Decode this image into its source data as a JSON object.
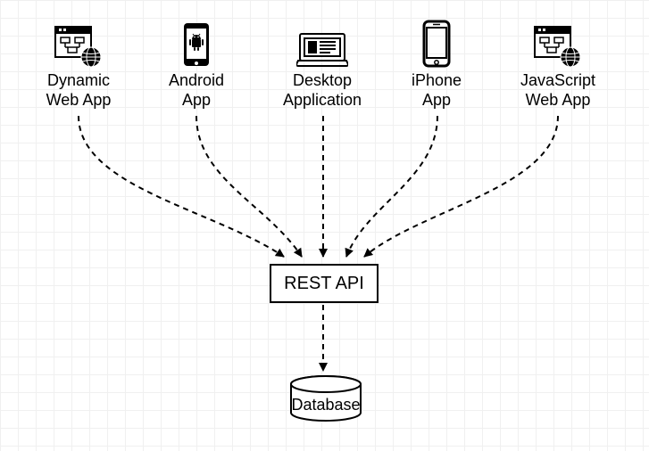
{
  "clients": {
    "dynamic": {
      "label": "Dynamic\nWeb App"
    },
    "android": {
      "label": "Android\nApp"
    },
    "desktop": {
      "label": "Desktop\nApplication"
    },
    "iphone": {
      "label": "iPhone\nApp"
    },
    "js": {
      "label": "JavaScript\nWeb App"
    }
  },
  "rest": {
    "label": "REST API"
  },
  "database": {
    "label": "Database"
  }
}
